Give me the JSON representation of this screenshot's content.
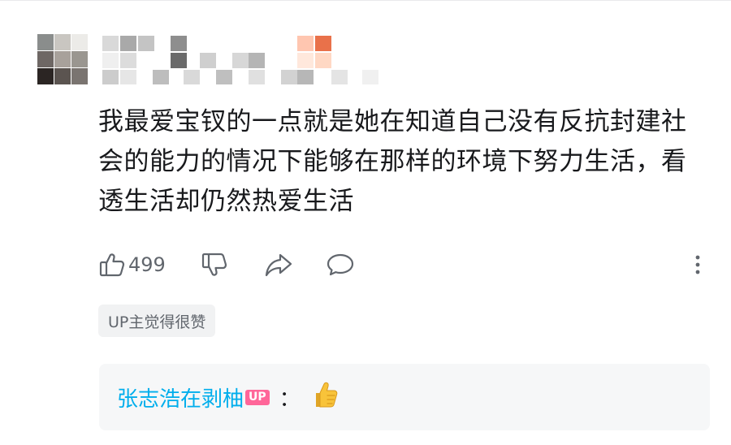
{
  "comment": {
    "text": "我最爱宝钗的一点就是她在知道自己没有反抗封建社会的能力的情况下能够在那样的环境下努力生活，看透生活却仍然热爱生活",
    "like_count": "499",
    "badge": "UP主觉得很赞"
  },
  "reply": {
    "author": "张志浩在剥柚",
    "up_label": "UP",
    "colon": "：",
    "emoji": "thumbs-up-emoji"
  },
  "icons": {
    "like": "thumbs-up-icon",
    "dislike": "thumbs-down-icon",
    "share": "share-icon",
    "reply": "comment-bubble-icon",
    "more": "more-vertical-icon"
  },
  "colors": {
    "author_link": "#00aeec",
    "up_tag": "#ff6699",
    "text": "#18191c",
    "secondary": "#61666d"
  }
}
